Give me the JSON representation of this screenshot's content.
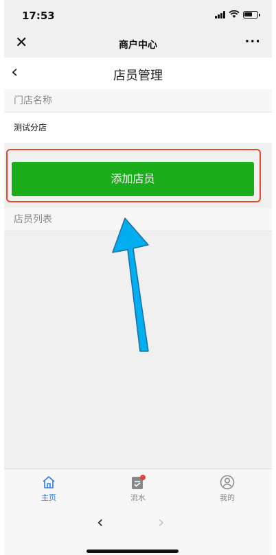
{
  "status_bar": {
    "time": "17:53"
  },
  "wechat_nav": {
    "close_icon": "✕",
    "title": "商户中心",
    "more_icon": "···"
  },
  "page": {
    "back_icon": "‹",
    "title": "店员管理"
  },
  "store_section": {
    "label": "门店名称",
    "value": "测试分店"
  },
  "add_button": {
    "label": "添加店员"
  },
  "staff_section": {
    "label": "店员列表"
  },
  "tabbar": {
    "items": [
      {
        "label": "主页",
        "icon": "home-icon",
        "active": true
      },
      {
        "label": "流水",
        "icon": "ledger-icon",
        "active": false,
        "badge": true
      },
      {
        "label": "我的",
        "icon": "user-icon",
        "active": false
      }
    ]
  },
  "browser": {
    "back_icon": "‹",
    "forward_icon": "›"
  },
  "colors": {
    "accent": "#1aad19",
    "highlight_border": "#e2492a",
    "annotation_arrow": "#00aeef",
    "tab_active": "#2c7be5",
    "badge": "#e64340"
  }
}
